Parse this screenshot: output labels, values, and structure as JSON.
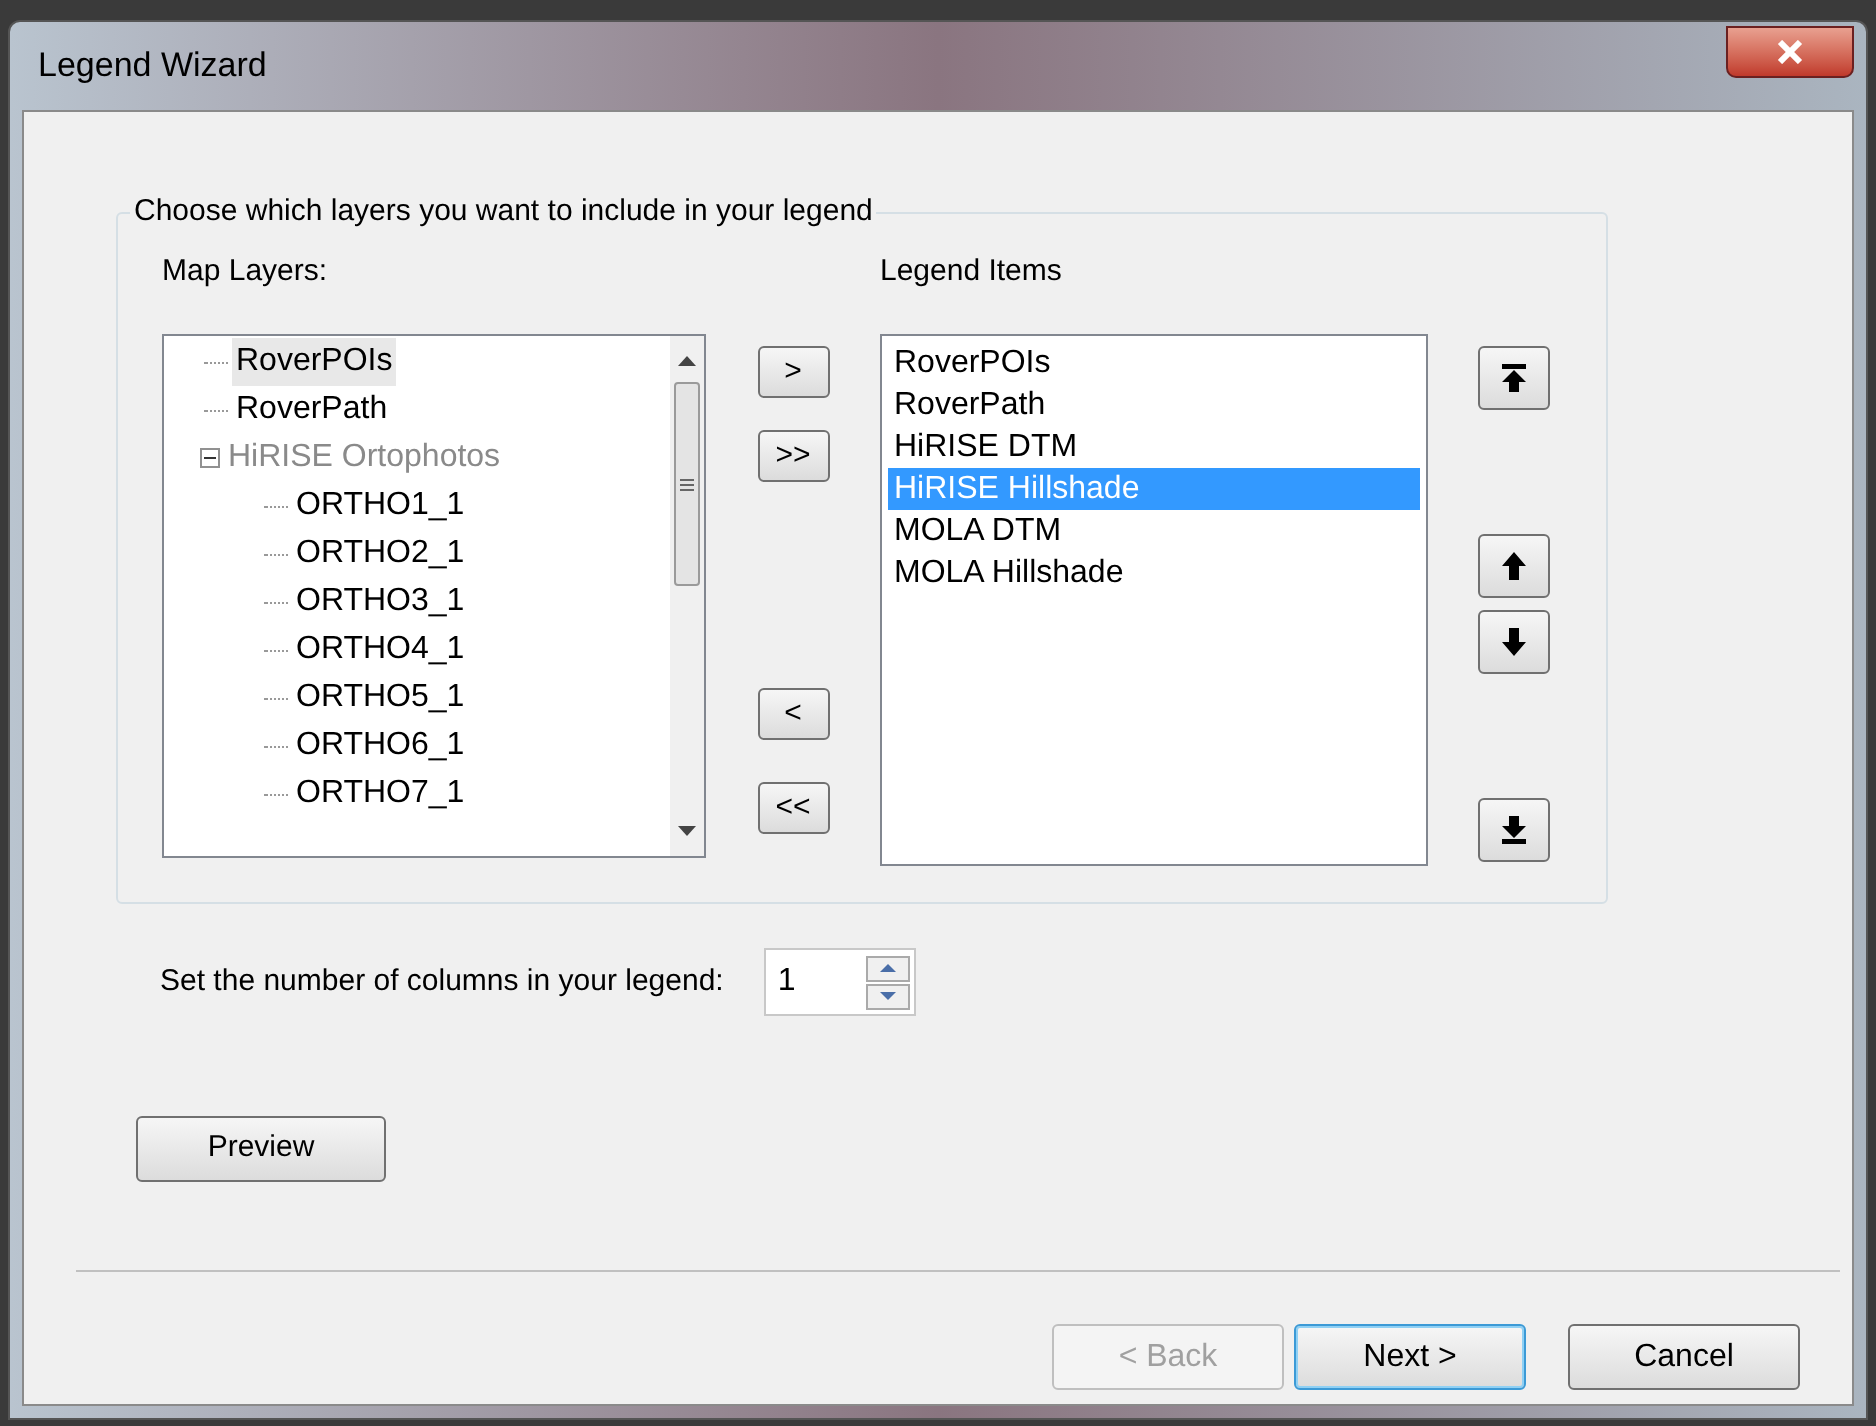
{
  "window": {
    "title": "Legend Wizard"
  },
  "group": {
    "title": "Choose which layers you want to include in your legend"
  },
  "map_layers": {
    "label": "Map Layers:",
    "items": [
      {
        "label": "RoverPOIs",
        "selected": true,
        "disabled": false
      },
      {
        "label": "RoverPath",
        "selected": false,
        "disabled": false
      },
      {
        "label": "HiRISE Ortophotos",
        "selected": false,
        "disabled": true,
        "expanded": true,
        "children": [
          {
            "label": "ORTHO1_1",
            "selected": false,
            "disabled": false
          },
          {
            "label": "ORTHO2_1",
            "selected": false,
            "disabled": false
          },
          {
            "label": "ORTHO3_1",
            "selected": false,
            "disabled": false
          },
          {
            "label": "ORTHO4_1",
            "selected": false,
            "disabled": false
          },
          {
            "label": "ORTHO5_1",
            "selected": false,
            "disabled": false
          },
          {
            "label": "ORTHO6_1",
            "selected": false,
            "disabled": false
          },
          {
            "label": "ORTHO7_1",
            "selected": false,
            "disabled": false
          }
        ]
      }
    ]
  },
  "transfer_buttons": [
    ">",
    ">>",
    "<",
    "<<"
  ],
  "legend_items": {
    "label": "Legend Items",
    "items": [
      {
        "label": "RoverPOIs",
        "selected": false
      },
      {
        "label": "RoverPath",
        "selected": false
      },
      {
        "label": "HiRISE DTM",
        "selected": false
      },
      {
        "label": "HiRISE Hillshade",
        "selected": true
      },
      {
        "label": "MOLA DTM",
        "selected": false
      },
      {
        "label": "MOLA Hillshade",
        "selected": false
      }
    ]
  },
  "columns": {
    "label": "Set the number of columns in your legend:",
    "value": "1"
  },
  "preview_button": "Preview",
  "footer_buttons": [
    {
      "label": "< Back",
      "disabled": true,
      "default": false
    },
    {
      "label": "Next >",
      "disabled": false,
      "default": true
    },
    {
      "label": "Cancel",
      "disabled": false,
      "default": false
    }
  ]
}
